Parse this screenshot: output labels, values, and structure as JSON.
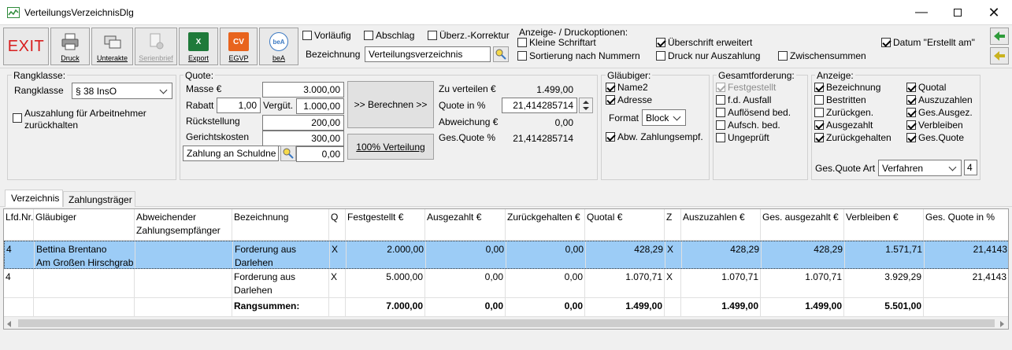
{
  "window": {
    "title": "VerteilungsVerzeichnisDlg"
  },
  "toolbar": {
    "exit_label": "EXIT",
    "buttons": [
      {
        "label": "Druck"
      },
      {
        "label": "Unterakte"
      },
      {
        "label": "Serienbrief"
      },
      {
        "label": "Export"
      },
      {
        "label": "EGVP"
      },
      {
        "label": "beA"
      }
    ],
    "icon_text": {
      "export": "X",
      "egvp": "CV",
      "bea": "beA"
    }
  },
  "options_left": {
    "vorlaeufig": "Vorläufig",
    "abschlag": "Abschlag",
    "ueberz": "Überz.-Korrektur",
    "bezeichnung_label": "Bezeichnung",
    "bezeichnung_value": "Verteilungsverzeichnis"
  },
  "anzeige_druck": {
    "title": "Anzeige- / Druckoptionen:",
    "kleine_schrift": "Kleine Schriftart",
    "sortierung": "Sortierung nach Nummern",
    "ueberschrift": "Überschrift erweitert",
    "druck_nur": "Druck nur Auszahlung",
    "zwischensummen": "Zwischensummen",
    "datum_erstellt": "Datum \"Erstellt am\""
  },
  "rangklasse": {
    "title": "Rangklasse:",
    "label": "Rangklasse",
    "value": "§ 38 InsO",
    "auszahlung_line1": "Auszahlung für Arbeitnehmer",
    "auszahlung_line2": "zurückhalten"
  },
  "quote": {
    "title": "Quote:",
    "masse_label": "Masse €",
    "masse_value": "3.000,00",
    "rabatt_label": "Rabatt",
    "rabatt_value": "1,00",
    "verguet_label": "Vergüt.",
    "verguet_value": "1.000,00",
    "rueck_label": "Rückstellung",
    "rueck_value": "200,00",
    "gericht_label": "Gerichtskosten",
    "gericht_value": "300,00",
    "zahlung_label": "Zahlung an Schuldne",
    "zahlung_value": "0,00",
    "berechnen": ">> Berechnen >>",
    "verteilung": "100% Verteilung",
    "zu_verteilen_label": "Zu verteilen €",
    "zu_verteilen_value": "1.499,00",
    "quote_label": "Quote in %",
    "quote_value": "21,414285714",
    "abweichung_label": "Abweichung €",
    "abweichung_value": "0,00",
    "ges_quote_label": "Ges.Quote %",
    "ges_quote_value": "21,414285714"
  },
  "glaeubiger": {
    "title": "Gläubiger:",
    "name2": "Name2",
    "adresse": "Adresse",
    "format_label": "Format",
    "format_value": "Block",
    "abw": "Abw. Zahlungsempf."
  },
  "gesamtforderung": {
    "title": "Gesamtforderung:",
    "items": [
      "Festgestellt",
      "f.d. Ausfall",
      "Auflösend bed.",
      "Aufsch. bed.",
      "Ungeprüft"
    ]
  },
  "anzeige": {
    "title": "Anzeige:",
    "left": [
      "Bezeichnung",
      "Bestritten",
      "Zurückgen.",
      "Ausgezahlt",
      "Zurückgehalten"
    ],
    "right": [
      "Quotal",
      "Auszuzahlen",
      "Ges.Ausgez.",
      "Verbleiben",
      "Ges.Quote"
    ],
    "ges_quote_art_label": "Ges.Quote Art",
    "ges_quote_art_value": "Verfahren",
    "ges_quote_art_num": "4"
  },
  "tabs": [
    {
      "label": "Verzeichnis"
    },
    {
      "label": "Zahlungsträger"
    }
  ],
  "table": {
    "headers": [
      "Lfd.Nr.",
      "Gläubiger",
      "Abweichender Zahlungsempfänger",
      "Bezeichnung",
      "Q",
      "Festgestellt €",
      "Ausgezahlt €",
      "Zurückgehalten €",
      "Quotal €",
      "Z",
      "Auszuzahlen €",
      "Ges. ausgezahlt €",
      "Verbleiben €",
      "Ges. Quote in %"
    ],
    "rows": [
      {
        "lfd": "4",
        "glaeubiger1": "Bettina Brentano",
        "glaeubiger2": "Am Großen Hirschgrab",
        "abw": "",
        "bez1": "Forderung aus",
        "bez2": "Darlehen",
        "q": "X",
        "fest": "2.000,00",
        "ausg": "0,00",
        "zurueck": "0,00",
        "quotal": "428,29",
        "z": "X",
        "ausz": "428,29",
        "gesausg": "428,29",
        "verbl": "1.571,71",
        "gesquote": "21,4143"
      },
      {
        "lfd": "4",
        "glaeubiger1": "",
        "glaeubiger2": "",
        "abw": "",
        "bez1": "Forderung aus",
        "bez2": "Darlehen",
        "q": "X",
        "fest": "5.000,00",
        "ausg": "0,00",
        "zurueck": "0,00",
        "quotal": "1.070,71",
        "z": "X",
        "ausz": "1.070,71",
        "gesausg": "1.070,71",
        "verbl": "3.929,29",
        "gesquote": "21,4143"
      }
    ],
    "sum": {
      "label": "Rangsummen:",
      "fest": "7.000,00",
      "ausg": "0,00",
      "zurueck": "0,00",
      "quotal": "1.499,00",
      "ausz": "1.499,00",
      "gesausg": "1.499,00",
      "verbl": "5.501,00"
    }
  }
}
